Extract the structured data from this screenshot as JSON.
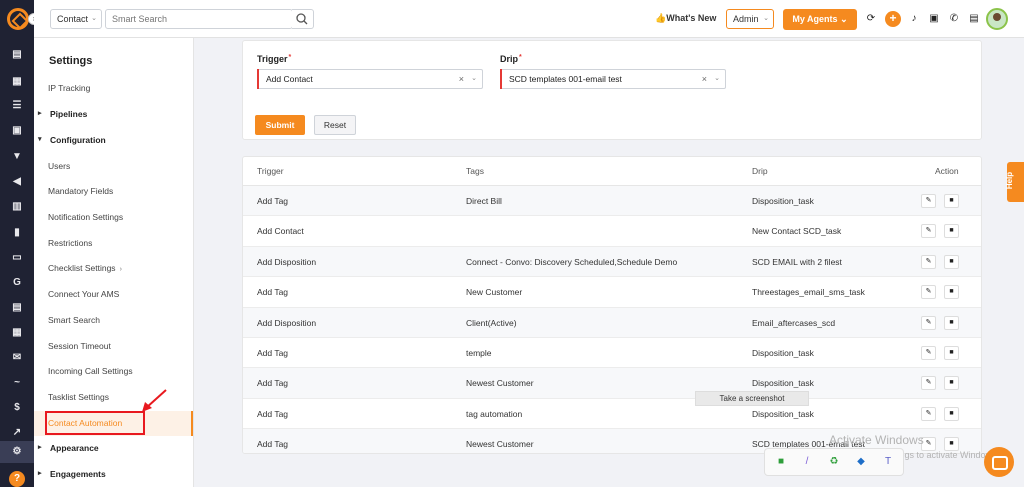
{
  "topbar": {
    "contact_type": "Contact",
    "search_placeholder": "Smart Search",
    "whats_new": "👍What's New",
    "role": "Admin",
    "my_agents": "My Agents ⌄"
  },
  "sidebar": {
    "title": "Settings",
    "items": [
      {
        "label": "IP Tracking",
        "group": false
      },
      {
        "label": "Pipelines",
        "group": true,
        "caret": "▸"
      },
      {
        "label": "Configuration",
        "group": true,
        "caret": "▾"
      },
      {
        "label": "Users",
        "group": false
      },
      {
        "label": "Mandatory Fields",
        "group": false
      },
      {
        "label": "Notification Settings",
        "group": false
      },
      {
        "label": "Restrictions",
        "group": false
      },
      {
        "label": "Checklist Settings",
        "group": false,
        "subchev": "›"
      },
      {
        "label": "Connect Your AMS",
        "group": false
      },
      {
        "label": "Smart Search",
        "group": false
      },
      {
        "label": "Session Timeout",
        "group": false
      },
      {
        "label": "Incoming Call Settings",
        "group": false
      },
      {
        "label": "Tasklist Settings",
        "group": false
      },
      {
        "label": "Contact Automation",
        "group": false,
        "active": true
      },
      {
        "label": "Appearance",
        "group": true,
        "caret": "▸"
      },
      {
        "label": "Engagements",
        "group": true,
        "caret": "▸"
      }
    ]
  },
  "form": {
    "trigger_label": "Trigger",
    "trigger_value": "Add Contact",
    "drip_label": "Drip",
    "drip_value": "SCD templates 001-email test",
    "required_mark": "*",
    "submit": "Submit",
    "reset": "Reset"
  },
  "table": {
    "headers": [
      "Trigger",
      "Tags",
      "Drip",
      "Action"
    ],
    "rows": [
      {
        "trigger": "Add Tag",
        "tags": "Direct Bill",
        "drip": "Disposition_task"
      },
      {
        "trigger": "Add Contact",
        "tags": "",
        "drip": "New Contact SCD_task"
      },
      {
        "trigger": "Add Disposition",
        "tags": "Connect - Convo: Discovery Scheduled,Schedule Demo",
        "drip": "SCD EMAIL with 2 filest"
      },
      {
        "trigger": "Add Tag",
        "tags": "New Customer",
        "drip": "Threestages_email_sms_task"
      },
      {
        "trigger": "Add Disposition",
        "tags": "Client(Active)",
        "drip": "Email_aftercases_scd"
      },
      {
        "trigger": "Add Tag",
        "tags": "temple",
        "drip": "Disposition_task"
      },
      {
        "trigger": "Add Tag",
        "tags": "Newest Customer",
        "drip": "Disposition_task"
      },
      {
        "trigger": "Add Tag",
        "tags": "tag automation",
        "drip": "Disposition_task"
      },
      {
        "trigger": "Add Tag",
        "tags": "Newest Customer",
        "drip": "SCD templates 001-email test"
      }
    ]
  },
  "help_tab": "Help",
  "tooltip": "Take a screenshot",
  "watermark": {
    "title": "Activate Windows",
    "subtitle": "Go to Settings to activate Windows."
  },
  "colors": {
    "accent": "#f58a1f",
    "rail": "#1f2233",
    "annotation": "#e8191f"
  }
}
